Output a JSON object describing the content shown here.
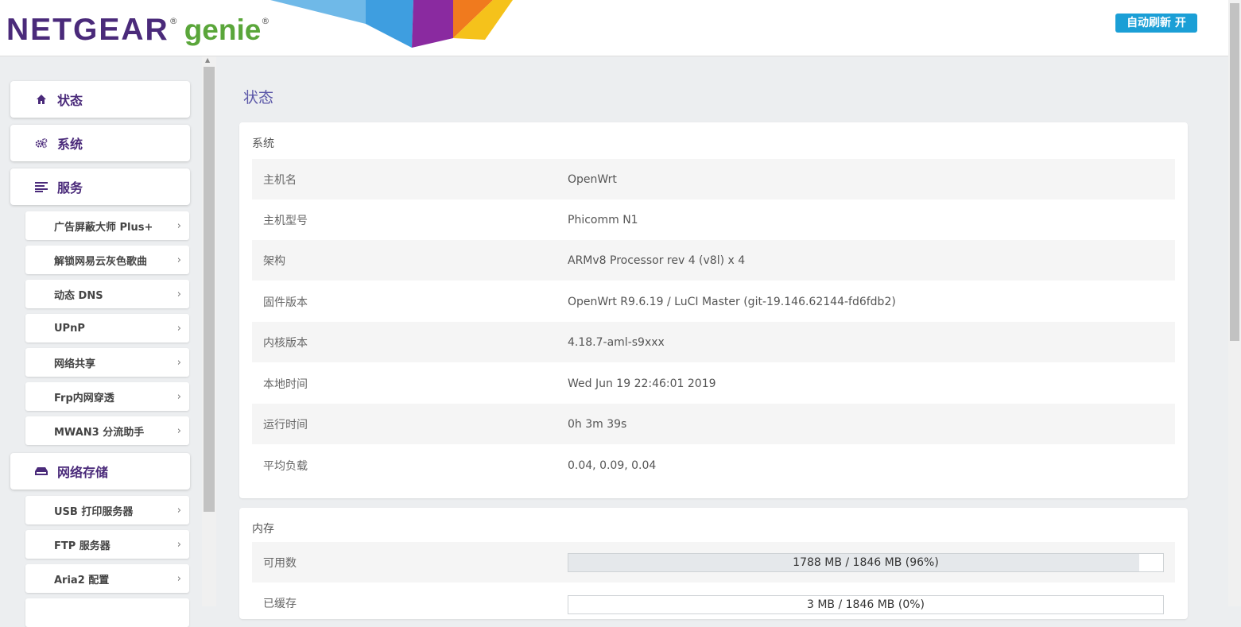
{
  "header": {
    "logo_netgear": "NETGEAR",
    "logo_genie": "genie",
    "logo_reg": "®",
    "refresh_button": "自动刷新 开"
  },
  "colors": {
    "brand_purple": "#4a2a7a",
    "brand_green": "#5aa63a",
    "accent_blue": "#1b9fd6",
    "title_purple": "#5b57a8"
  },
  "sidebar": {
    "main": [
      {
        "label": "状态",
        "icon": "home-icon"
      },
      {
        "label": "系统",
        "icon": "gears-icon"
      },
      {
        "label": "服务",
        "icon": "list-icon"
      },
      {
        "label": "网络存储",
        "icon": "drive-icon"
      }
    ],
    "services": [
      "广告屏蔽大师 Plus+",
      "解锁网易云灰色歌曲",
      "动态 DNS",
      "UPnP",
      "网络共享",
      "Frp内网穿透",
      "MWAN3 分流助手"
    ],
    "storage": [
      "USB 打印服务器",
      "FTP 服务器",
      "Aria2 配置"
    ],
    "chevron": "›"
  },
  "main": {
    "title": "状态",
    "system": {
      "title": "系统",
      "rows": [
        {
          "key": "主机名",
          "value": "OpenWrt"
        },
        {
          "key": "主机型号",
          "value": "Phicomm N1"
        },
        {
          "key": "架构",
          "value": "ARMv8 Processor rev 4 (v8l) x 4"
        },
        {
          "key": "固件版本",
          "value": "OpenWrt R9.6.19 / LuCI Master (git-19.146.62144-fd6fdb2)"
        },
        {
          "key": "内核版本",
          "value": "4.18.7-aml-s9xxx"
        },
        {
          "key": "本地时间",
          "value": "Wed Jun 19 22:46:01 2019"
        },
        {
          "key": "运行时间",
          "value": "0h 3m 39s"
        },
        {
          "key": "平均负载",
          "value": "0.04, 0.09, 0.04"
        }
      ]
    },
    "memory": {
      "title": "内存",
      "rows": [
        {
          "key": "可用数",
          "value": "1788 MB / 1846 MB (96%)",
          "fraction": 0.96
        },
        {
          "key": "已缓存",
          "value": "3 MB / 1846 MB (0%)",
          "fraction": 0.0
        }
      ]
    }
  }
}
